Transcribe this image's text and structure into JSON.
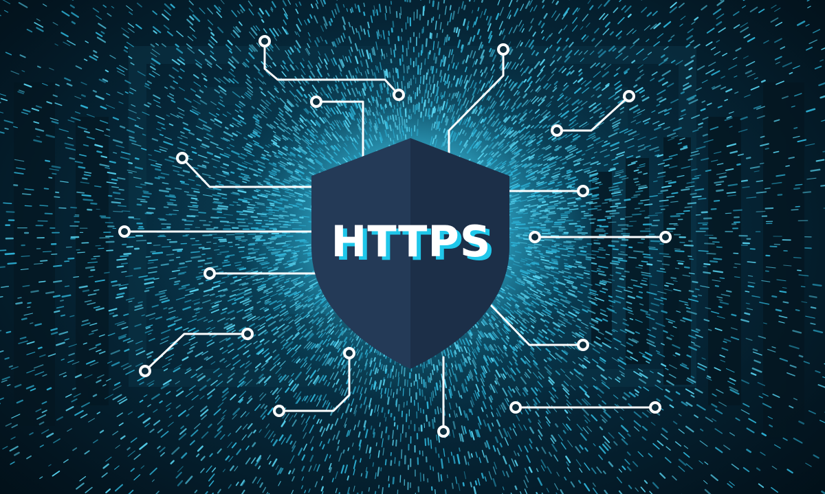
{
  "badge": {
    "label": "HTTPS",
    "colors": {
      "shield_left": "#243a57",
      "shield_right": "#1c2f48",
      "text": "#ffffff",
      "text_shadow": "#1fc7ea",
      "circuit": "#ffffff",
      "glow": "#7fe8ff"
    }
  },
  "icons": [
    "shield-icon",
    "circuit-node-icon",
    "data-stream-particles"
  ]
}
